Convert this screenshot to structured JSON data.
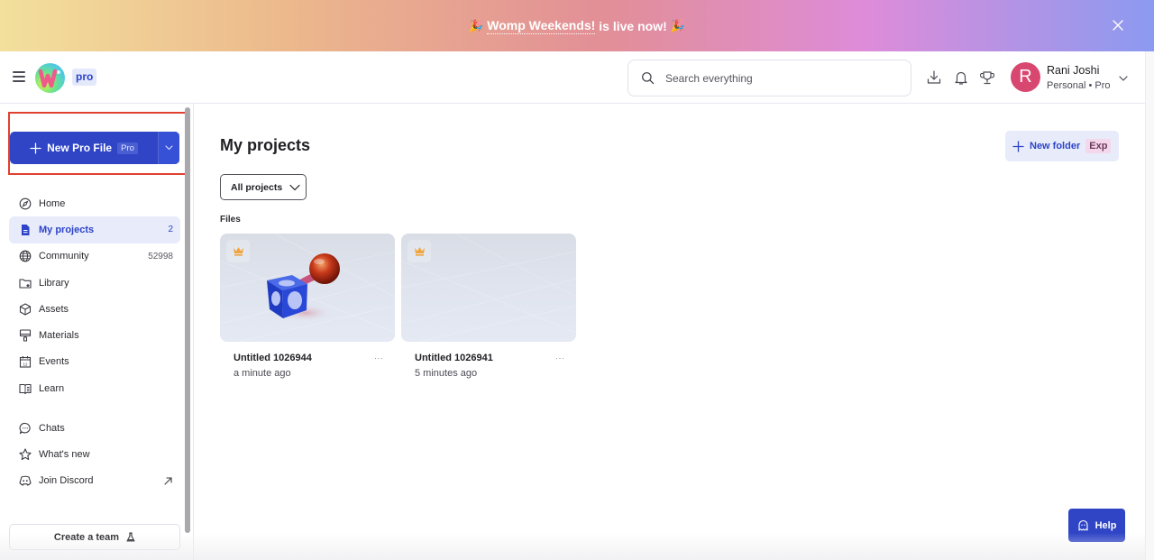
{
  "banner": {
    "emoji": "🎉",
    "link_text": "Womp Weekends!",
    "suffix_text": "is live now!",
    "gradient_colors": [
      "#f3e09d",
      "#ecb88c",
      "#e28f96",
      "#de8cd9",
      "#8b9af0"
    ]
  },
  "header": {
    "plan_badge": "pro",
    "search_placeholder": "Search everything",
    "icons": [
      "download-icon",
      "bell-icon",
      "trophy-icon"
    ],
    "user": {
      "initial": "R",
      "name": "Rani Joshi",
      "plan": "Personal • Pro",
      "avatar_color": "#d8476f"
    }
  },
  "sidebar": {
    "new_file": {
      "label": "New Pro File",
      "tag": "Pro"
    },
    "items": [
      {
        "label": "Home",
        "icon": "compass-icon",
        "count": ""
      },
      {
        "label": "My projects",
        "icon": "document-icon",
        "count": "2",
        "active": true
      },
      {
        "label": "Community",
        "icon": "globe-icon",
        "count": "52998"
      },
      {
        "label": "Library",
        "icon": "folder-star-icon",
        "count": ""
      },
      {
        "label": "Assets",
        "icon": "cube-icon",
        "count": ""
      },
      {
        "label": "Materials",
        "icon": "paint-roller-icon",
        "count": ""
      },
      {
        "label": "Events",
        "icon": "calendar-icon",
        "count": ""
      },
      {
        "label": "Learn",
        "icon": "book-icon",
        "count": ""
      }
    ],
    "secondary_items": [
      {
        "label": "Chats",
        "icon": "chat-icon"
      },
      {
        "label": "What's new",
        "icon": "star-icon"
      },
      {
        "label": "Join Discord",
        "icon": "discord-icon",
        "external": true
      }
    ],
    "create_team_label": "Create a team"
  },
  "main": {
    "title": "My projects",
    "new_folder_label": "New folder",
    "new_folder_tag": "Exp",
    "filter_label": "All projects",
    "files_label": "Files",
    "files": [
      {
        "name": "Untitled 1026944",
        "time": "a minute ago",
        "has_preview": true
      },
      {
        "name": "Untitled 1026941",
        "time": "5 minutes ago",
        "has_preview": false
      }
    ],
    "help_label": "Help"
  },
  "colors": {
    "accent": "#2f45c6",
    "accent_light": "#e8ebf9",
    "highlight_outline": "#e0412f"
  }
}
